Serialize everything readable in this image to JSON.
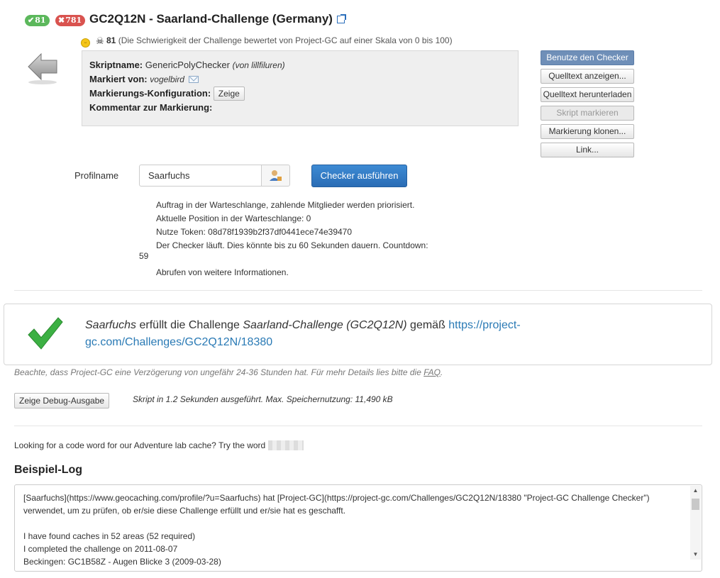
{
  "header": {
    "found_count": "81",
    "dnf_count": "781",
    "found_color": "#5cb85c",
    "dnf_color": "#d9534f",
    "title": "GC2Q12N - Saarland-Challenge (Germany)"
  },
  "difficulty": {
    "score": "81",
    "description": "(Die Schwierigkeit der Challenge bewertet von Project-GC auf einer Skala von 0 bis 100)"
  },
  "script": {
    "name_label": "Skriptname:",
    "name_value": "GenericPolyChecker",
    "author": "(von lillfiluren)",
    "tagged_by_label": "Markiert von:",
    "tagged_by_value": "vogelbird",
    "config_label": "Markierungs-Konfiguration:",
    "config_button": "Zeige",
    "comment_label": "Kommentar zur Markierung:"
  },
  "side_buttons": {
    "use_checker": "Benutze den Checker",
    "show_source": "Quelltext anzeigen...",
    "download_source": "Quelltext herunterladen",
    "tag_script": "Skript markieren",
    "clone_tag": "Markierung klonen...",
    "link": "Link..."
  },
  "profile": {
    "label": "Profilname",
    "value": "Saarfuchs",
    "run_button": "Checker ausführen"
  },
  "status_lines": {
    "line1": "Auftrag in der Warteschlange, zahlende Mitglieder werden priorisiert.",
    "line2": "Aktuelle Position in der Warteschlange: 0",
    "line3": "Nutze Token: 08d78f1939b2f37df0441ece74e39470",
    "line4": "Der Checker läuft. Dies könnte bis zu 60 Sekunden dauern. Countdown:",
    "countdown": "59",
    "line5": "Abrufen von weitere Informationen."
  },
  "result": {
    "user": "Saarfuchs",
    "text1": " erfüllt die Challenge ",
    "challenge": "Saarland-Challenge (GC2Q12N)",
    "text2": " gemäß ",
    "link": "https://project-gc.com/Challenges/GC2Q12N/18380",
    "check_color": "#3cb043"
  },
  "note": {
    "text": "Beachte, dass Project-GC eine Verzögerung von ungefähr 24-36 Stunden hat. Für mehr Details lies bitte die ",
    "faq": "FAQ",
    "end": "."
  },
  "debug": {
    "button": "Zeige Debug-Ausgabe",
    "exec_info": "Skript in 1.2 Sekunden ausgeführt. Max. Speichernutzung: 11,490 kB"
  },
  "codeword": {
    "text": "Looking for a code word for our Adventure lab cache? Try the word"
  },
  "example_log": {
    "title": "Beispiel-Log",
    "line1": "[Saarfuchs](https://www.geocaching.com/profile/?u=Saarfuchs) hat [Project-GC](https://project-gc.com/Challenges/GC2Q12N/18380 \"Project-GC Challenge Checker\") verwendet, um zu prüfen, ob er/sie diese Challenge erfüllt und er/sie hat es geschafft.",
    "line2": "I have found caches in 52 areas (52 required)",
    "line3": "I completed the challenge on 2011-08-07",
    "line4": "Beckingen: GC1B58Z - Augen Blicke 3 (2009-03-28)"
  }
}
